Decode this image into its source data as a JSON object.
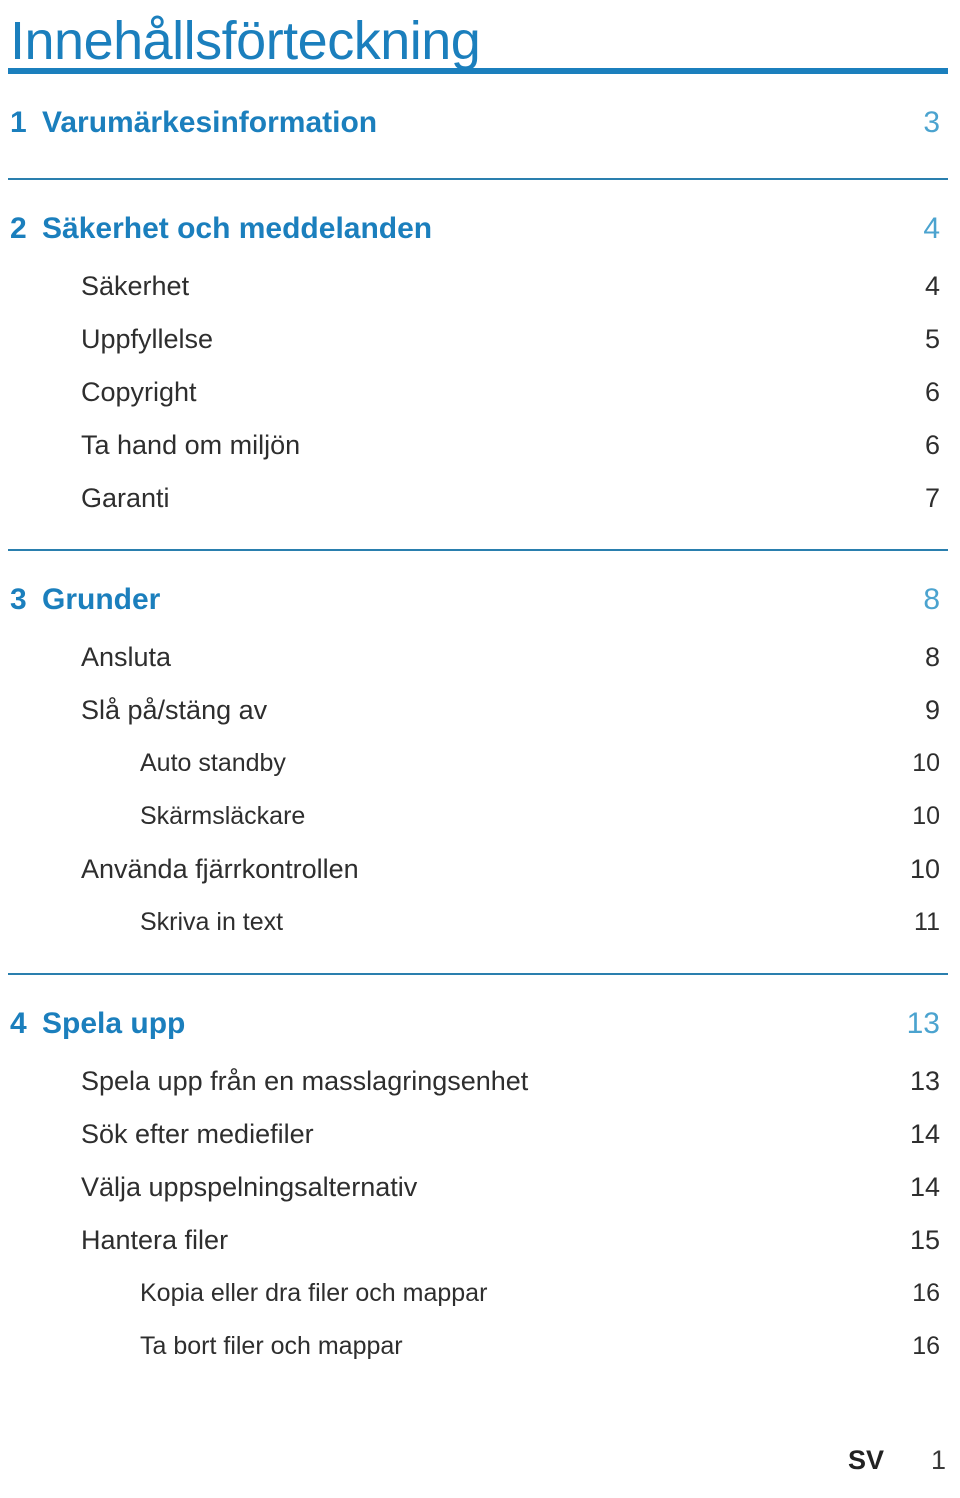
{
  "document": {
    "title": "Innehållsförteckning",
    "accent_color": "#1b7fbd",
    "rule_color": "#2a7fae",
    "body_text_color": "#2e2e2e"
  },
  "toc": {
    "sections": [
      {
        "heading": {
          "number": "1",
          "label": "Varumärkesinformation",
          "page": "3"
        },
        "items": []
      },
      {
        "heading": {
          "number": "2",
          "label": "Säkerhet och meddelanden",
          "page": "4"
        },
        "items": [
          {
            "level": 1,
            "label": "Säkerhet",
            "page": "4"
          },
          {
            "level": 1,
            "label": "Uppfyllelse",
            "page": "5"
          },
          {
            "level": 1,
            "label": "Copyright",
            "page": "6"
          },
          {
            "level": 1,
            "label": "Ta hand om miljön",
            "page": "6"
          },
          {
            "level": 1,
            "label": "Garanti",
            "page": "7"
          }
        ]
      },
      {
        "heading": {
          "number": "3",
          "label": "Grunder",
          "page": "8"
        },
        "items": [
          {
            "level": 1,
            "label": "Ansluta",
            "page": "8"
          },
          {
            "level": 1,
            "label": "Slå på/stäng av",
            "page": "9"
          },
          {
            "level": 2,
            "label": "Auto standby",
            "page": "10"
          },
          {
            "level": 2,
            "label": "Skärmsläckare",
            "page": "10"
          },
          {
            "level": 1,
            "label": "Använda fjärrkontrollen",
            "page": "10"
          },
          {
            "level": 2,
            "label": "Skriva in text",
            "page": "11"
          }
        ]
      },
      {
        "heading": {
          "number": "4",
          "label": "Spela upp",
          "page": "13"
        },
        "items": [
          {
            "level": 1,
            "label": "Spela upp från en masslagringsenhet",
            "page": "13"
          },
          {
            "level": 1,
            "label": "Sök efter mediefiler",
            "page": "14"
          },
          {
            "level": 1,
            "label": "Välja uppspelningsalternativ",
            "page": "14"
          },
          {
            "level": 1,
            "label": "Hantera filer",
            "page": "15"
          },
          {
            "level": 2,
            "label": "Kopia eller dra filer och mappar",
            "page": "16"
          },
          {
            "level": 2,
            "label": "Ta bort filer och mappar",
            "page": "16"
          }
        ]
      }
    ]
  },
  "footer": {
    "language": "SV",
    "page_number": "1"
  }
}
